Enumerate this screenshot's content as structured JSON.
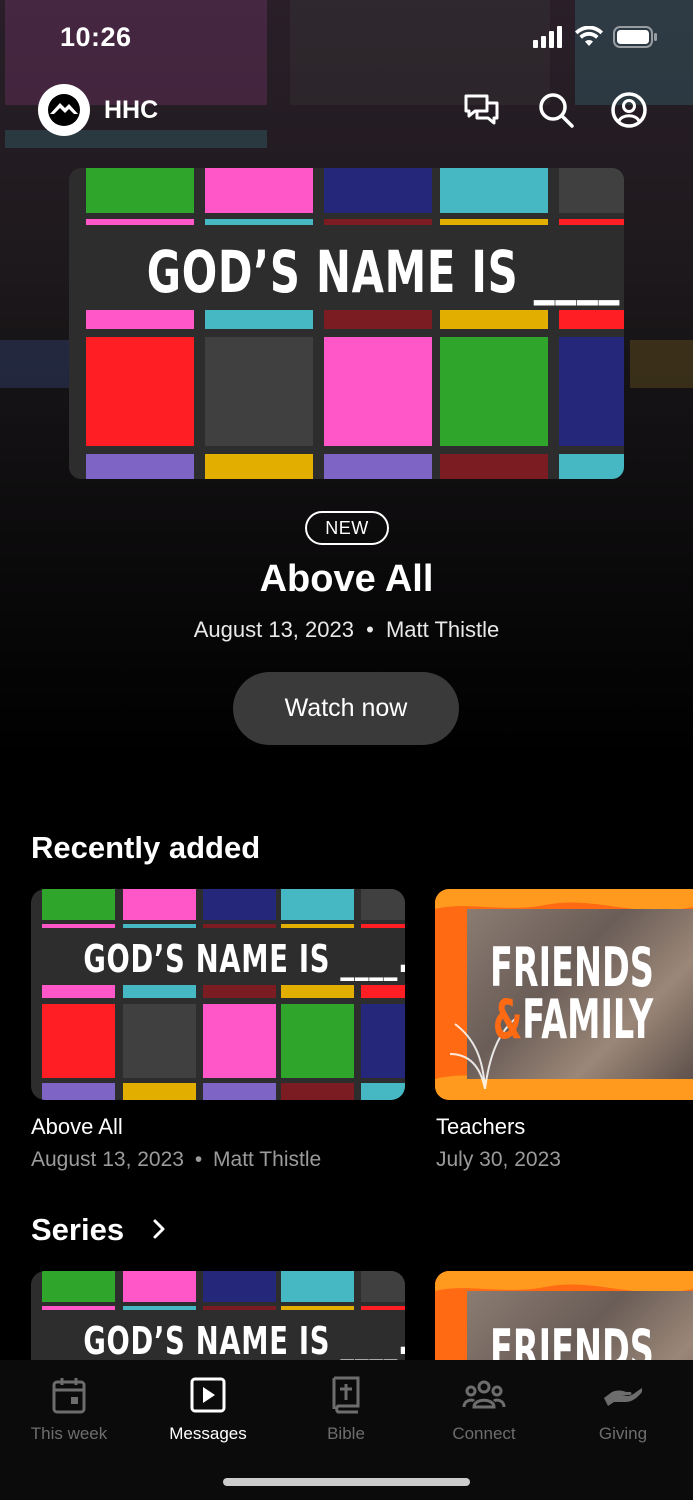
{
  "status_bar": {
    "time": "10:26"
  },
  "header": {
    "brand": "HHC"
  },
  "hero": {
    "art_text": "GOD’S NAME IS ____.",
    "badge": "NEW",
    "title": "Above All",
    "date": "August 13, 2023",
    "separator": "•",
    "speaker": "Matt Thistle",
    "cta": "Watch now"
  },
  "recently_added": {
    "heading": "Recently added",
    "items": [
      {
        "title": "Above All",
        "date": "August 13, 2023",
        "separator": "•",
        "speaker": "Matt Thistle",
        "art_text": "GOD’S NAME IS ____."
      },
      {
        "title": "Teachers",
        "date": "July 30, 2023",
        "art_line1": "FRIENDS",
        "art_amp": "&",
        "art_line2": "FAMILY"
      }
    ]
  },
  "series": {
    "heading": "Series",
    "items": [
      {
        "art_text": "GOD’S NAME IS ____."
      },
      {
        "art_line1": "FRIENDS"
      }
    ]
  },
  "tabs": [
    {
      "label": "This week",
      "icon": "calendar-icon",
      "active": false
    },
    {
      "label": "Messages",
      "icon": "play-square-icon",
      "active": true
    },
    {
      "label": "Bible",
      "icon": "bible-icon",
      "active": false
    },
    {
      "label": "Connect",
      "icon": "people-icon",
      "active": false
    },
    {
      "label": "Giving",
      "icon": "giving-hand-icon",
      "active": false
    }
  ],
  "colors": {
    "green": "#2fa52b",
    "pink": "#ff57c8",
    "navy": "#25277a",
    "teal": "#45b8c4",
    "gray": "#404040",
    "red": "#ff1e24",
    "maroon": "#7b1b22",
    "gold": "#e2ae00",
    "purple": "#7d64c5",
    "orange": "#ff6a13"
  }
}
